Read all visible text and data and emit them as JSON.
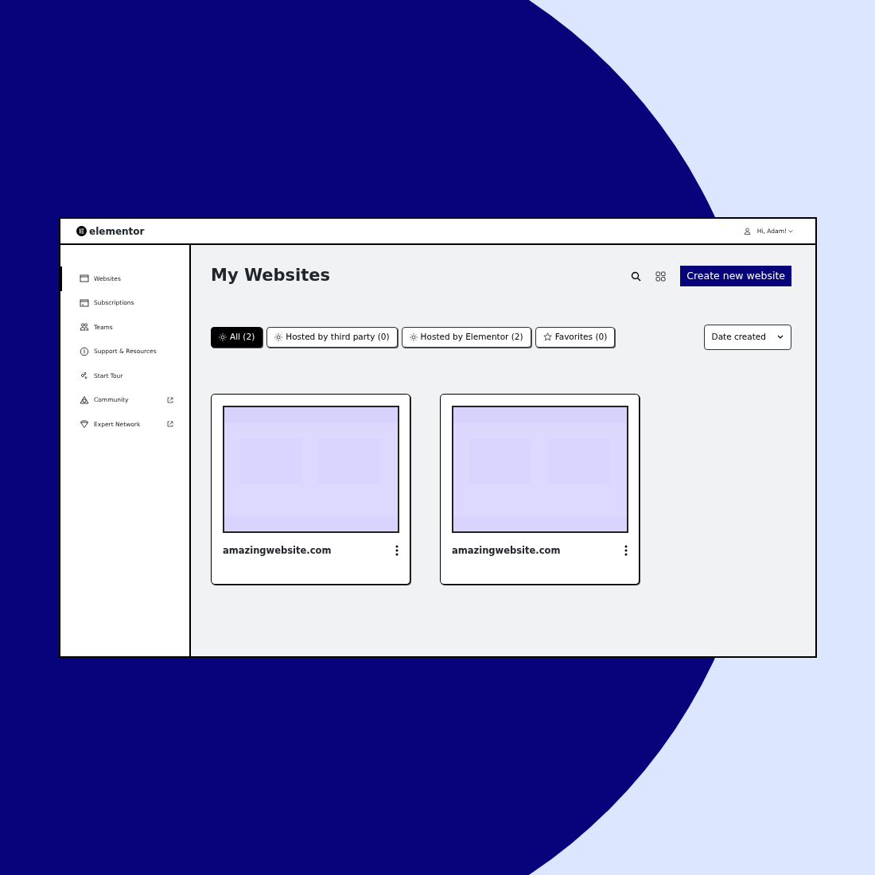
{
  "header": {
    "logo": "elementor",
    "user": "Hi, Adam!"
  },
  "sidebar": {
    "items": [
      {
        "label": "Websites",
        "selected": true,
        "external": false
      },
      {
        "label": "Subscriptions",
        "selected": false,
        "external": false
      },
      {
        "label": "Teams",
        "selected": false,
        "external": false
      },
      {
        "label": "Support & Resources",
        "selected": false,
        "external": false
      },
      {
        "label": "Start Tour",
        "selected": false,
        "external": false
      },
      {
        "label": "Community",
        "selected": false,
        "external": true
      },
      {
        "label": "Expert Network",
        "selected": false,
        "external": true
      }
    ]
  },
  "main": {
    "title": "My Websites",
    "create_button": "Create new website",
    "filters": [
      {
        "label": "All (2)",
        "selected": true,
        "kind": "sun"
      },
      {
        "label": "Hosted by third party (0)",
        "selected": false,
        "kind": "sun"
      },
      {
        "label": "Hosted by Elementor (2)",
        "selected": false,
        "kind": "sun"
      },
      {
        "label": "Favorites (0)",
        "selected": false,
        "kind": "star"
      }
    ],
    "sort": "Date created",
    "sites": [
      {
        "name": "amazingwebsite.com",
        "kind": "picture"
      },
      {
        "name": "amazingwebsite.com",
        "kind": "picture"
      }
    ]
  }
}
